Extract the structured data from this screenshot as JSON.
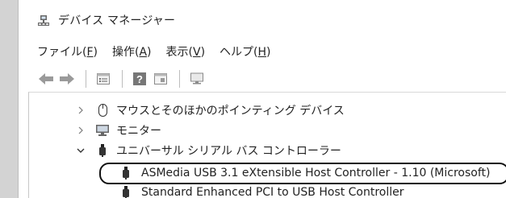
{
  "window": {
    "title": "デバイス マネージャー"
  },
  "menu": [
    {
      "pre": "ファイル(",
      "key": "F",
      "post": ")"
    },
    {
      "pre": "操作(",
      "key": "A",
      "post": ")"
    },
    {
      "pre": "表示(",
      "key": "V",
      "post": ")"
    },
    {
      "pre": "ヘルプ(",
      "key": "H",
      "post": ")"
    }
  ],
  "tree": {
    "items": [
      {
        "label": "マウスとそのほかのポインティング デバイス",
        "state": "collapsed"
      },
      {
        "label": "モニター",
        "state": "collapsed"
      },
      {
        "label": "ユニバーサル シリアル バス コントローラー",
        "state": "expanded"
      },
      {
        "label": "ASMedia USB 3.1 eXtensible Host Controller - 1.10 (Microsoft)",
        "state": "child",
        "highlighted": true
      },
      {
        "label": "Standard Enhanced PCI to USB Host Controller",
        "state": "child"
      }
    ]
  },
  "icons": {
    "title": "device-manager-icon",
    "back": "back-arrow-icon",
    "forward": "forward-arrow-icon",
    "properties": "properties-icon",
    "help": "help-icon",
    "update": "update-driver-icon",
    "monitor": "monitor-icon"
  }
}
